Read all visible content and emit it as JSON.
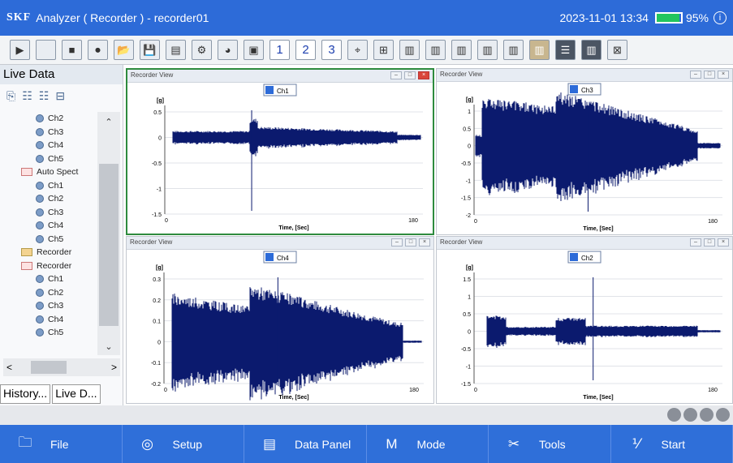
{
  "titlebar": {
    "logo": "SKF",
    "title": "Analyzer ( Recorder ) - recorder01",
    "datetime": "2023-11-01 13:34",
    "battery": "95%",
    "battery_level": 0.95,
    "info_icon": "info-icon"
  },
  "toolbar": {
    "buttons": [
      {
        "icon": "play-icon"
      },
      {
        "icon": "blank-icon"
      },
      {
        "icon": "stop-icon"
      },
      {
        "icon": "record-icon"
      },
      {
        "icon": "open-folder-icon"
      },
      {
        "icon": "save-icon"
      },
      {
        "icon": "document-icon"
      },
      {
        "icon": "gear-icon"
      },
      {
        "icon": "pie-chart-icon"
      },
      {
        "icon": "display-icon"
      },
      {
        "icon": "layout-1-icon",
        "label": "1"
      },
      {
        "icon": "layout-2-icon",
        "label": "2"
      },
      {
        "icon": "layout-3-icon",
        "label": "3"
      },
      {
        "icon": "cursor-icon"
      },
      {
        "icon": "add-panel-icon"
      },
      {
        "icon": "chart-panel-icon"
      },
      {
        "icon": "chart-panel-icon"
      },
      {
        "icon": "chart-panel-icon"
      },
      {
        "icon": "chart-panel-icon"
      },
      {
        "icon": "chart-panel-icon"
      },
      {
        "icon": "highlight-panel-icon"
      },
      {
        "icon": "rows-icon"
      },
      {
        "icon": "columns-icon"
      },
      {
        "icon": "close-panel-icon"
      }
    ]
  },
  "sidebar": {
    "title": "Live Data",
    "tree": [
      {
        "label": "Ch2",
        "kind": "channel"
      },
      {
        "label": "Ch3",
        "kind": "channel"
      },
      {
        "label": "Ch4",
        "kind": "channel"
      },
      {
        "label": "Ch5",
        "kind": "channel"
      },
      {
        "label": "Auto Spect",
        "kind": "spectrum"
      },
      {
        "label": "Ch1",
        "kind": "channel"
      },
      {
        "label": "Ch2",
        "kind": "channel"
      },
      {
        "label": "Ch3",
        "kind": "channel"
      },
      {
        "label": "Ch4",
        "kind": "channel"
      },
      {
        "label": "Ch5",
        "kind": "channel"
      },
      {
        "label": "Recorder",
        "kind": "folder"
      },
      {
        "label": "Recorder",
        "kind": "spectrum"
      },
      {
        "label": "Ch1",
        "kind": "channel"
      },
      {
        "label": "Ch2",
        "kind": "channel"
      },
      {
        "label": "Ch3",
        "kind": "channel"
      },
      {
        "label": "Ch4",
        "kind": "channel"
      },
      {
        "label": "Ch5",
        "kind": "channel"
      }
    ],
    "tabs": [
      "History...",
      "Live D..."
    ]
  },
  "panels": [
    {
      "header": "Recorder View",
      "channel": "Ch1",
      "unit": "[g]",
      "yticks": [
        "0.5",
        "0",
        "-0.5",
        "-1",
        "-1.5"
      ],
      "xticks": [
        "0",
        "180"
      ],
      "xlabel": "Time, [Sec]",
      "active": true
    },
    {
      "header": "Recorder View",
      "channel": "Ch3",
      "unit": "[g]",
      "yticks": [
        "1",
        "0.5",
        "0",
        "-0.5",
        "-1",
        "-1.5",
        "-2"
      ],
      "xticks": [
        "0",
        "180"
      ],
      "xlabel": "Time, [Sec]",
      "active": false
    },
    {
      "header": "Recorder View",
      "channel": "Ch4",
      "unit": "[g]",
      "yticks": [
        "0.3",
        "0.2",
        "0.1",
        "0",
        "-0.1",
        "-0.2"
      ],
      "xticks": [
        "0",
        "180"
      ],
      "xlabel": "Time, [Sec]",
      "active": false
    },
    {
      "header": "Recorder View",
      "channel": "Ch2",
      "unit": "[g]",
      "yticks": [
        "1.5",
        "1",
        "0.5",
        "0",
        "-0.5",
        "-1",
        "-1.5"
      ],
      "xticks": [
        "0",
        "180"
      ],
      "xlabel": "Time, [Sec]",
      "active": false
    }
  ],
  "bottombar": [
    {
      "label": "File",
      "icon": "folder-icon"
    },
    {
      "label": "Setup",
      "icon": "setup-icon"
    },
    {
      "label": "Data Panel",
      "icon": "data-panel-icon"
    },
    {
      "label": "Mode",
      "icon": "mode-icon"
    },
    {
      "label": "Tools",
      "icon": "tools-icon"
    },
    {
      "label": "Start",
      "icon": "start-icon"
    }
  ],
  "colors": {
    "titlebar": "#2d6bd8",
    "wave": "#0b1a6e",
    "active_border": "#2e8b3e"
  }
}
